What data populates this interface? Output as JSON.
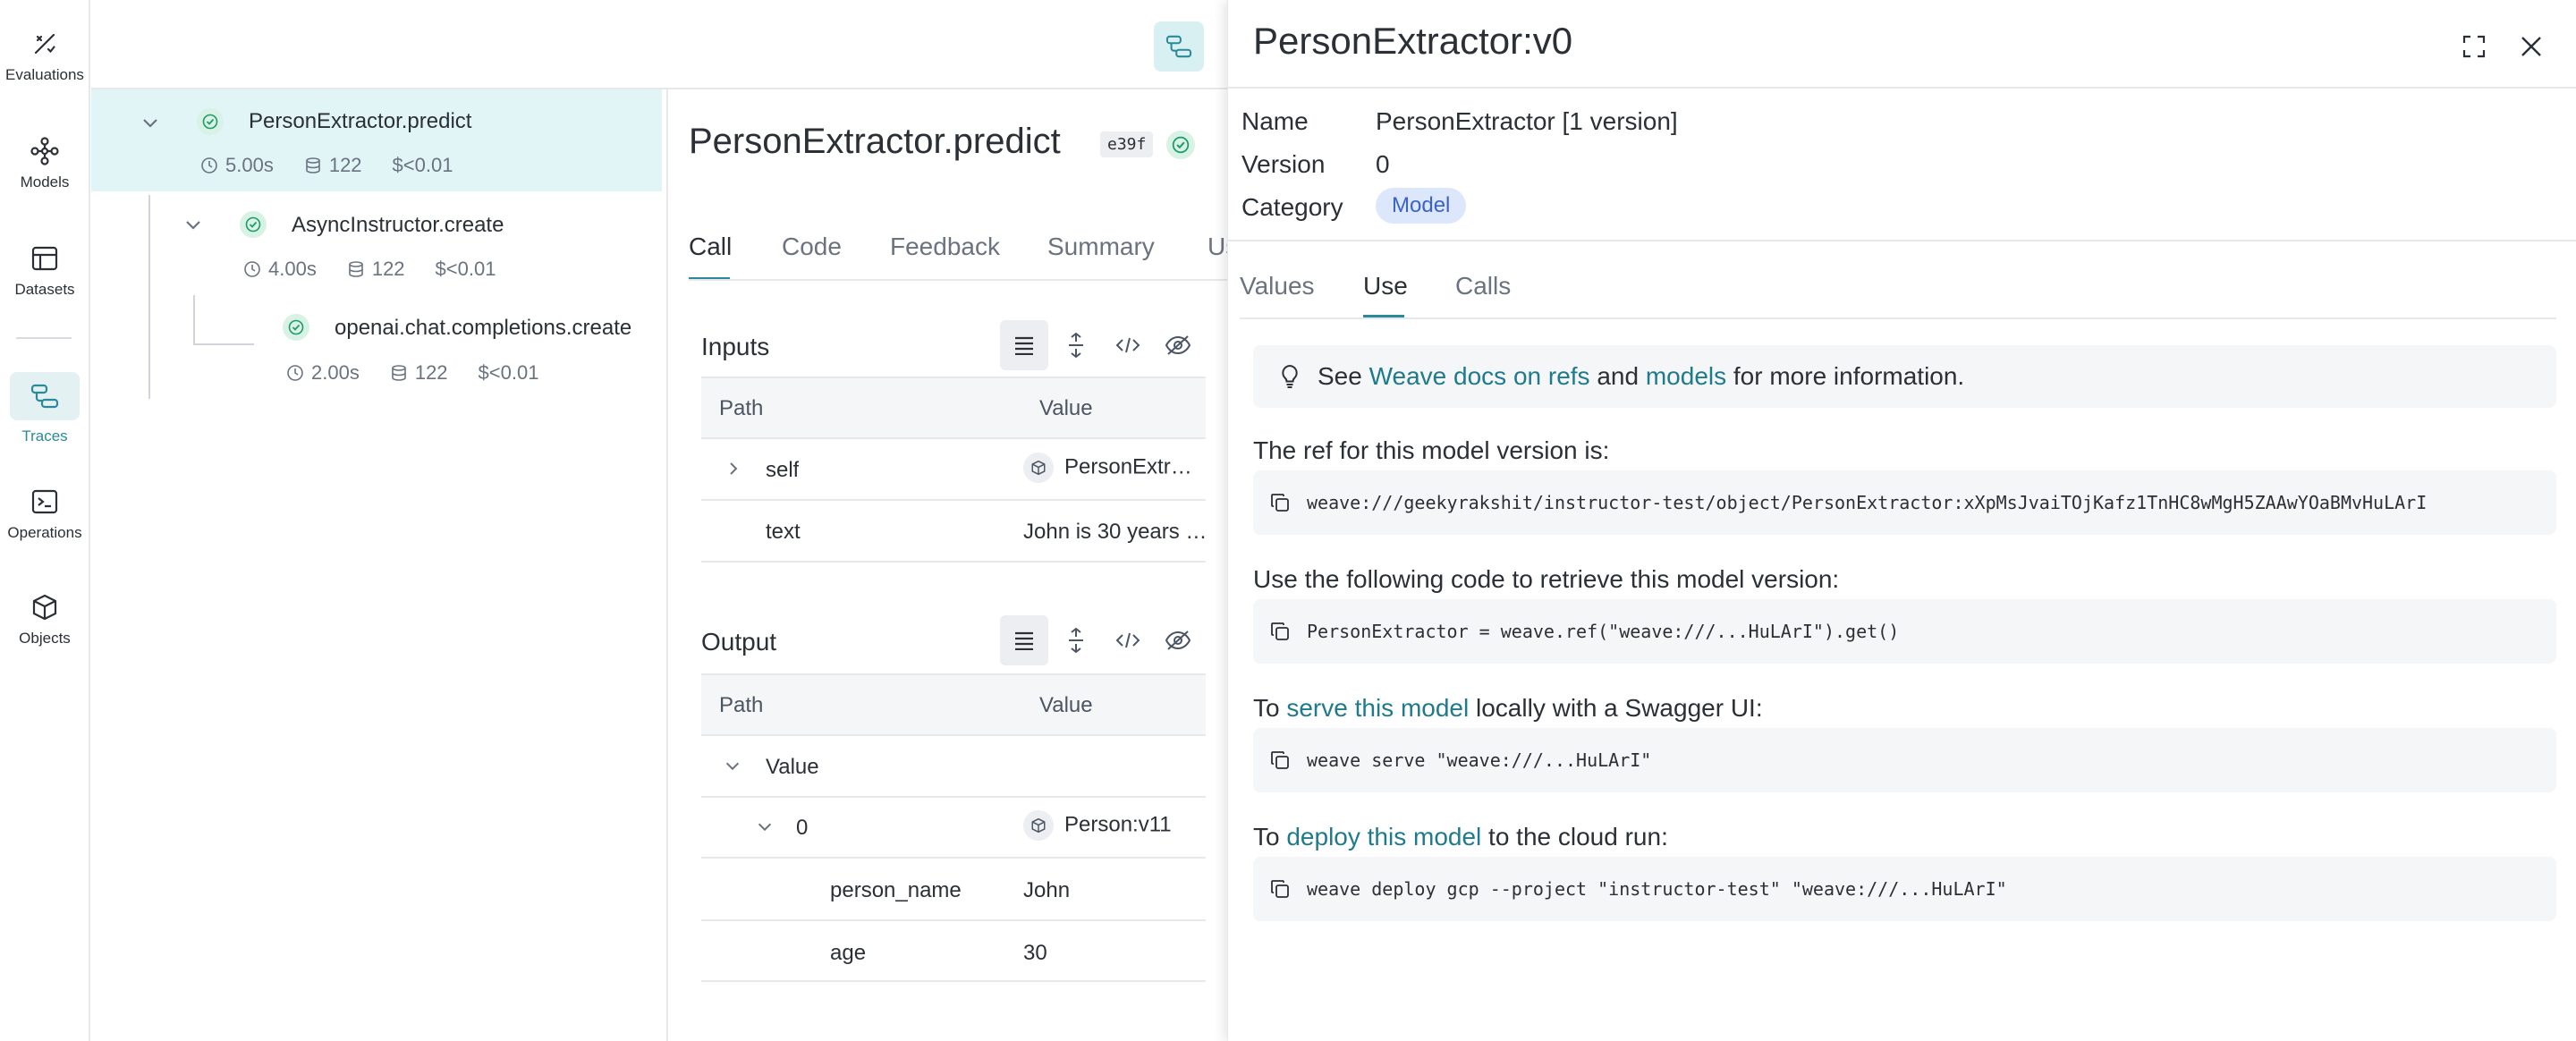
{
  "nav": {
    "items": [
      {
        "label": "Evaluations",
        "icon": "evaluations-icon"
      },
      {
        "label": "Models",
        "icon": "models-icon"
      },
      {
        "label": "Datasets",
        "icon": "datasets-icon"
      },
      {
        "label": "Traces",
        "icon": "traces-icon",
        "active": true
      },
      {
        "label": "Operations",
        "icon": "operations-icon"
      },
      {
        "label": "Objects",
        "icon": "objects-icon"
      }
    ]
  },
  "tree": {
    "nodes": [
      {
        "name": "PersonExtractor.predict",
        "duration": "5.00s",
        "tokens": "122",
        "cost": "$<0.01"
      },
      {
        "name": "AsyncInstructor.create",
        "duration": "4.00s",
        "tokens": "122",
        "cost": "$<0.01"
      },
      {
        "name": "openai.chat.completions.create",
        "duration": "2.00s",
        "tokens": "122",
        "cost": "$<0.01"
      }
    ]
  },
  "call": {
    "title": "PersonExtractor.predict",
    "hash": "e39f",
    "tabs": [
      "Call",
      "Code",
      "Feedback",
      "Summary",
      "Us"
    ],
    "inputs": {
      "title": "Inputs",
      "col_path": "Path",
      "col_value": "Value",
      "rows": [
        {
          "path": "self",
          "value": "PersonExtr…"
        },
        {
          "path": "text",
          "value": "John is 30 years …"
        }
      ]
    },
    "output": {
      "title": "Output",
      "col_path": "Path",
      "col_value": "Value",
      "rows": [
        {
          "path": "Value",
          "value": ""
        },
        {
          "path": "0",
          "value": "Person:v11"
        },
        {
          "path": "person_name",
          "value": "John"
        },
        {
          "path": "age",
          "value": "30"
        }
      ]
    }
  },
  "drawer": {
    "title": "PersonExtractor:v0",
    "name_label": "Name",
    "name_value": "PersonExtractor [1 version]",
    "version_label": "Version",
    "version_value": "0",
    "category_label": "Category",
    "category_value": "Model",
    "tabs": [
      "Values",
      "Use",
      "Calls"
    ],
    "info": {
      "see": "See",
      "link1": "Weave docs on refs",
      "and": "and",
      "link2": "models",
      "rest": "for more information."
    },
    "ref_heading": "The ref for this model version is:",
    "ref_code": "weave:///geekyrakshit/instructor-test/object/PersonExtractor:xXpMsJvaiTOjKafz1TnHC8wMgH5ZAAwYOaBMvHuLArI",
    "retrieve_heading": "Use the following code to retrieve this model version:",
    "retrieve_code": "PersonExtractor = weave.ref(\"weave:///...HuLArI\").get()",
    "serve": {
      "pre": "To",
      "link": "serve this model",
      "post": "locally with a Swagger UI:"
    },
    "serve_code": "weave serve \"weave:///...HuLArI\"",
    "deploy": {
      "pre": "To",
      "link": "deploy this model",
      "post": "to the cloud run:"
    },
    "deploy_code": "weave deploy gcp --project \"instructor-test\" \"weave:///...HuLArI\""
  },
  "colors": {
    "accent": "#2a8a9a",
    "link": "#1f7a8c",
    "selected_row": "#e1f5f7"
  }
}
